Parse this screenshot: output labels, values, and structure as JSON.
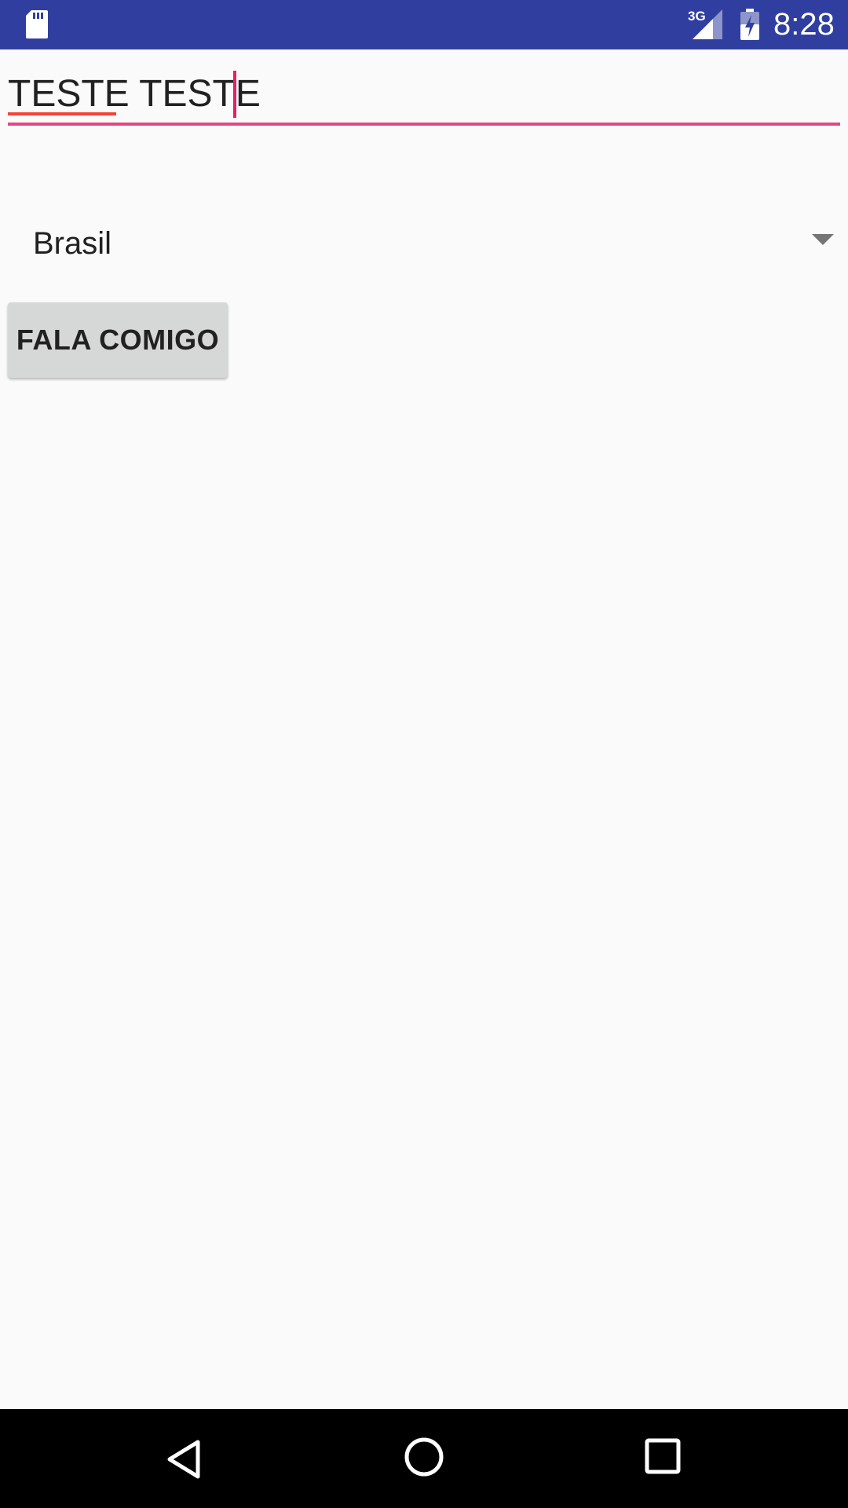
{
  "status_bar": {
    "network_type": "3G",
    "time": "8:28",
    "icons": [
      "sd-card-icon",
      "cell-signal-icon",
      "battery-charging-icon"
    ],
    "background_color": "#303f9f"
  },
  "main": {
    "text_field": {
      "value": "TESTE TESTE",
      "accent_color": "#e5467f"
    },
    "spinner": {
      "selected": "Brasil"
    },
    "button": {
      "label": "FALA COMIGO"
    }
  },
  "nav_bar": {
    "icons": [
      "back-icon",
      "home-icon",
      "recents-icon"
    ]
  }
}
